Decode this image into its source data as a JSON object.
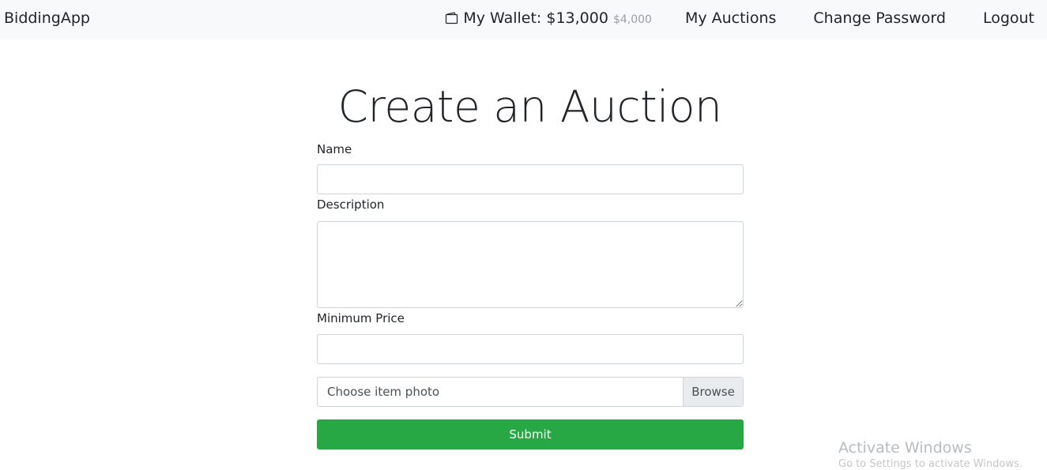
{
  "navbar": {
    "brand": "BiddingApp",
    "wallet_icon": "wallet-icon",
    "wallet_label": "My Wallet: $13,000",
    "wallet_sub": "$4,000",
    "links": {
      "my_auctions": "My Auctions",
      "change_password": "Change Password",
      "logout": "Logout"
    }
  },
  "page": {
    "title": "Create an Auction"
  },
  "form": {
    "name_label": "Name",
    "name_value": "",
    "description_label": "Description",
    "description_value": "",
    "min_price_label": "Minimum Price",
    "min_price_value": "",
    "file_placeholder": "Choose item photo",
    "browse_label": "Browse",
    "submit_label": "Submit"
  },
  "watermark": {
    "title": "Activate Windows",
    "subtitle": "Go to Settings to activate Windows."
  },
  "colors": {
    "navbar_bg": "#f8f9fa",
    "submit_bg": "#28a745",
    "border": "#ced4da"
  }
}
